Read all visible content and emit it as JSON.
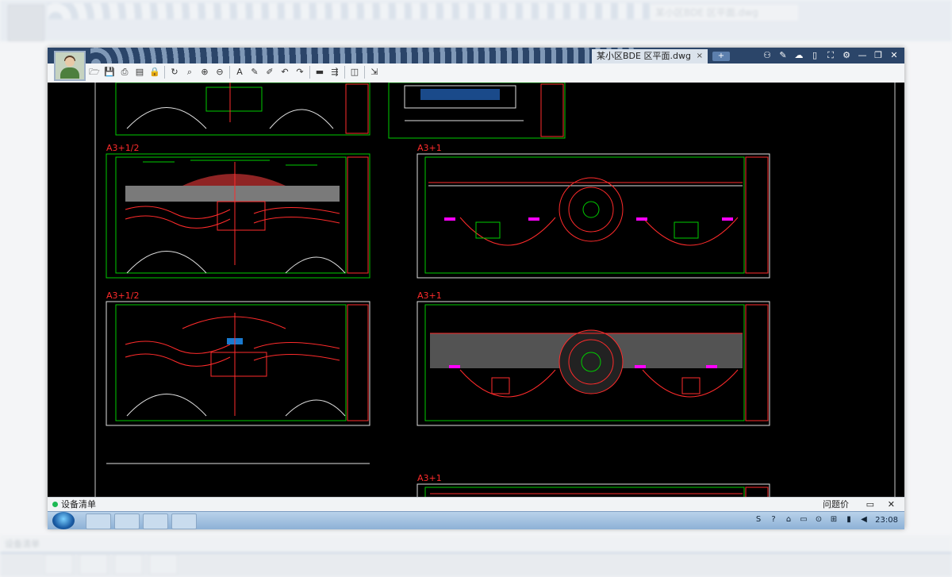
{
  "window": {
    "tab_title": "某小区BDE 区平面.dwg",
    "tab_close": "×",
    "add_tab": "+",
    "title_icons": [
      "users-icon",
      "edit-icon",
      "chat-icon",
      "phone-icon",
      "fullscreen-icon",
      "gear-icon",
      "minimize-icon",
      "restore-icon",
      "close-icon"
    ],
    "title_glyphs": [
      "⚇",
      "✎",
      "☁",
      "▯",
      "⛶",
      "⚙",
      "—",
      "❐",
      "✕"
    ]
  },
  "toolbar": {
    "tools": [
      {
        "name": "open-icon",
        "glyph": "🗁"
      },
      {
        "name": "save-icon",
        "glyph": "💾"
      },
      {
        "name": "print-icon",
        "glyph": "⎙"
      },
      {
        "name": "pdf-icon",
        "glyph": "▤"
      },
      {
        "name": "lock-icon",
        "glyph": "🔒"
      },
      {
        "name": "rotate-icon",
        "glyph": "↻"
      },
      {
        "name": "zoom-window-icon",
        "glyph": "⌕"
      },
      {
        "name": "zoom-in-icon",
        "glyph": "⊕"
      },
      {
        "name": "zoom-out-icon",
        "glyph": "⊖"
      },
      {
        "name": "text-icon",
        "glyph": "A"
      },
      {
        "name": "pencil-icon",
        "glyph": "✎"
      },
      {
        "name": "marker-icon",
        "glyph": "✐"
      },
      {
        "name": "undo-icon",
        "glyph": "↶"
      },
      {
        "name": "redo-icon",
        "glyph": "↷"
      },
      {
        "name": "measure-icon",
        "glyph": "▬"
      },
      {
        "name": "dimension-icon",
        "glyph": "⇶"
      },
      {
        "name": "layers-icon",
        "glyph": "◫"
      },
      {
        "name": "export-icon",
        "glyph": "⇲"
      }
    ]
  },
  "drawing": {
    "sheet_labels": [
      "A3+1/2",
      "A3+1",
      "A3+1/2",
      "A3+1",
      "A3+1"
    ]
  },
  "statusbar": {
    "label": "设备清单",
    "right_label": "问题价",
    "chat_glyph": "▭",
    "close_glyph": "✕"
  },
  "taskbar": {
    "tray_glyphs": [
      "S",
      "?",
      "⌂",
      "▭",
      "⊙",
      "⊞",
      "▮",
      "◀"
    ],
    "time": "23:08"
  },
  "colors": {
    "titlebar": "#2b4569",
    "canvas": "#000000",
    "border_green": "#00cc00",
    "cad_red": "#ff2b2b",
    "cad_magenta": "#ff00ff",
    "cad_white": "#e0e0e0"
  }
}
